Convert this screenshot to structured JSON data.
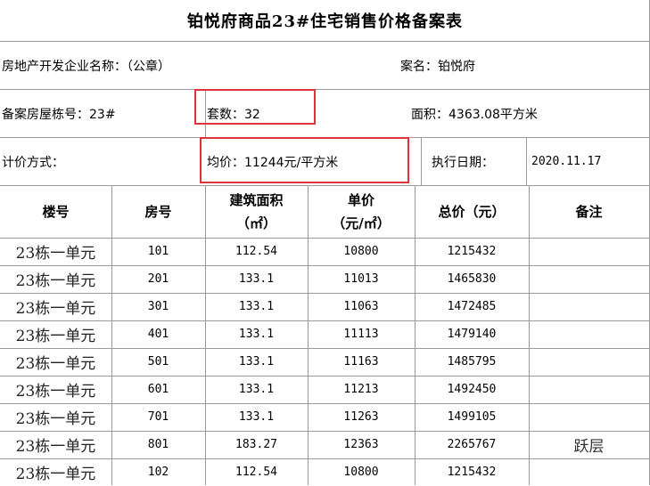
{
  "title": "铂悦府商品23#住宅销售价格备案表",
  "info": {
    "developer_label": "房地产开发企业名称：（公章）",
    "project_label": "案名：铂悦府",
    "building_label": "备案房屋栋号：23#",
    "units_label": "套数：32",
    "area_label": "面积：4363.08平方米",
    "pricing_label": "计价方式：",
    "avg_price_label": "均价：11244元/平方米",
    "exec_date_label": "执行日期：",
    "exec_date_value": "2020.11.17"
  },
  "table": {
    "headers": {
      "building": "楼号",
      "room": "房号",
      "area_line1": "建筑面积",
      "area_line2": "（㎡）",
      "price_line1": "单价",
      "price_line2": "（元/㎡）",
      "total": "总价（元）",
      "note": "备注"
    },
    "rows": [
      {
        "building": "23栋一单元",
        "room": "101",
        "area": "112.54",
        "price": "10800",
        "total": "1215432",
        "note": ""
      },
      {
        "building": "23栋一单元",
        "room": "201",
        "area": "133.1",
        "price": "11013",
        "total": "1465830",
        "note": ""
      },
      {
        "building": "23栋一单元",
        "room": "301",
        "area": "133.1",
        "price": "11063",
        "total": "1472485",
        "note": ""
      },
      {
        "building": "23栋一单元",
        "room": "401",
        "area": "133.1",
        "price": "11113",
        "total": "1479140",
        "note": ""
      },
      {
        "building": "23栋一单元",
        "room": "501",
        "area": "133.1",
        "price": "11163",
        "total": "1485795",
        "note": ""
      },
      {
        "building": "23栋一单元",
        "room": "601",
        "area": "133.1",
        "price": "11213",
        "total": "1492450",
        "note": ""
      },
      {
        "building": "23栋一单元",
        "room": "701",
        "area": "133.1",
        "price": "11263",
        "total": "1499105",
        "note": ""
      },
      {
        "building": "23栋一单元",
        "room": "801",
        "area": "183.27",
        "price": "12363",
        "total": "2265767",
        "note": "跃层"
      },
      {
        "building": "23栋一单元",
        "room": "102",
        "area": "112.54",
        "price": "10800",
        "total": "1215432",
        "note": ""
      }
    ]
  },
  "colors": {
    "grid": "#9a9a9a",
    "highlight": "#e0323a"
  }
}
